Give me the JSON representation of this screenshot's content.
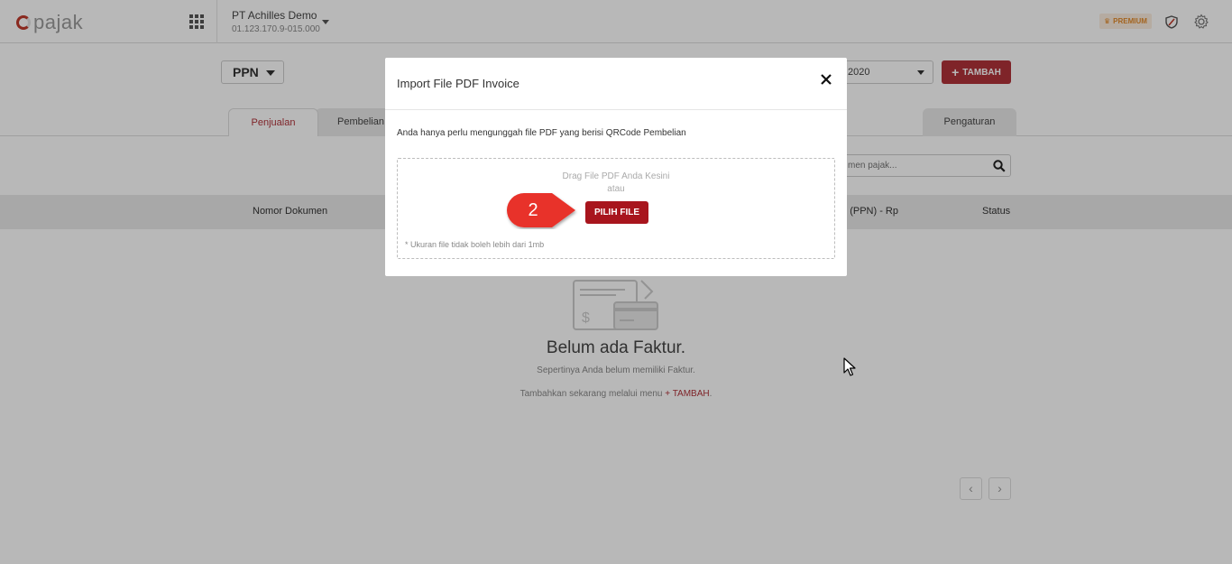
{
  "header": {
    "logo_text": "pajak",
    "company_name": "PT Achilles Demo",
    "company_npwp": "01.123.170.9-015.000",
    "premium_label": "PREMIUM",
    "icons": [
      "grid-icon",
      "shield-icon",
      "gear-icon"
    ]
  },
  "toolbar": {
    "tax_type": "PPN",
    "year_value": "2020",
    "add_label": "TAMBAH"
  },
  "tabs": [
    {
      "label": "Penjualan",
      "active": true
    },
    {
      "label": "Pembelian",
      "active": false
    },
    {
      "label": "Pengaturan",
      "active": false
    }
  ],
  "search": {
    "placeholder": "men pajak..."
  },
  "table": {
    "columns": [
      "Nomor Dokumen",
      "P (PPN) - Rp",
      "Status"
    ]
  },
  "empty_state": {
    "title": "Belum ada Faktur.",
    "subtitle": "Sepertinya Anda belum memiliki Faktur.",
    "cta_prefix": "Tambahkan sekarang melalui menu",
    "cta_link": "+ TAMBAH",
    "cta_suffix": "."
  },
  "pagination": {
    "prev": "‹",
    "next": "›"
  },
  "modal": {
    "title": "Import File PDF Invoice",
    "description": "Anda hanya perlu mengunggah file PDF yang berisi QRCode Pembelian",
    "drop_hint": "Drag File PDF Anda Kesini",
    "or_text": "atau",
    "choose_button": "PILIH FILE",
    "size_note": "* Ukuran file tidak boleh lebih dari 1mb"
  },
  "step_marker": "2",
  "colors": {
    "brand": "#b0323a",
    "button_dark": "#a8151d",
    "callout": "#e8302c",
    "premium": "#e38b2c"
  }
}
